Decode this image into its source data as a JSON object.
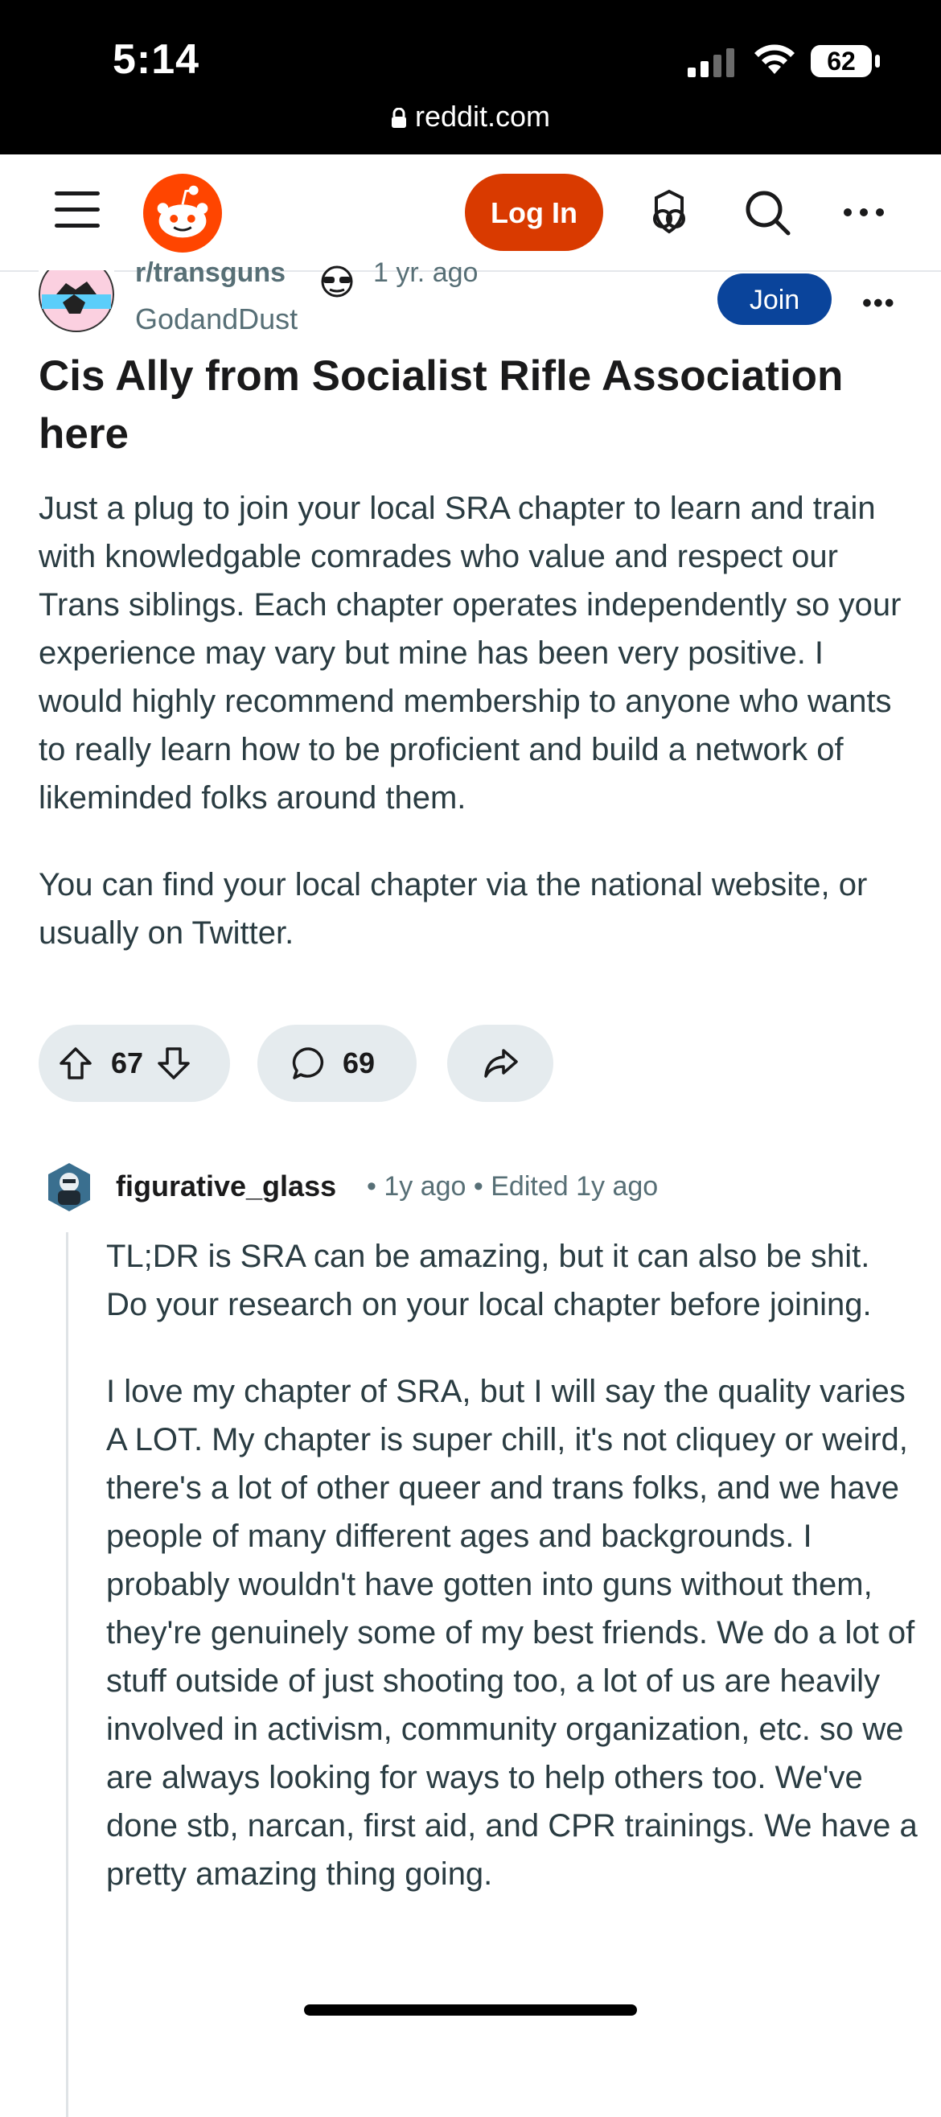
{
  "status_bar": {
    "time": "5:14",
    "battery": "62",
    "url": "reddit.com"
  },
  "header": {
    "login_label": "Log In",
    "icons": [
      "menu-icon",
      "reddit-logo",
      "log-in-button",
      "shield-icon",
      "search-icon",
      "more-icon"
    ]
  },
  "post": {
    "subreddit": "r/transguns",
    "time": "1 yr. ago",
    "author": "GodandDust",
    "join_label": "Join",
    "title": "Cis Ally from Socialist Rifle Association here",
    "body_p1": "Just a plug to join your local SRA chapter to learn and train with knowledgable comrades who value and respect our Trans siblings. Each chapter operates independently so your experience may vary but mine has been very positive. I would highly recommend membership to anyone who wants to really learn how to be proficient and build a network of likeminded folks around them.",
    "body_p2": "You can find your local chapter via the national website, or usually on Twitter.",
    "votes": "67",
    "comments": "69"
  },
  "comment": {
    "author": "figurative_glass",
    "time": "1y ago",
    "edited": "Edited 1y ago",
    "p1": "TL;DR is SRA can be amazing, but it can also be shit. Do your research on your local chapter before joining.",
    "p2": "I love my chapter of SRA, but I will say the quality varies A LOT. My chapter is super chill, it's not cliquey or weird, there's a lot of other queer and trans folks, and we have people of many different ages and backgrounds. I probably wouldn't have gotten into guns without them, they're genuinely some of my best friends. We do a lot of stuff outside of just shooting too, a lot of us are heavily involved in activism, community organization, etc. so we are always looking for ways to help others too. We've done stb, narcan, first aid, and CPR trainings. We have a pretty amazing thing going."
  },
  "colors": {
    "reddit_orange": "#ff4500",
    "login_bg": "#d93a00",
    "join_bg": "#0a449b",
    "pill_bg": "#e5ebee",
    "meta_text": "#576f76"
  }
}
